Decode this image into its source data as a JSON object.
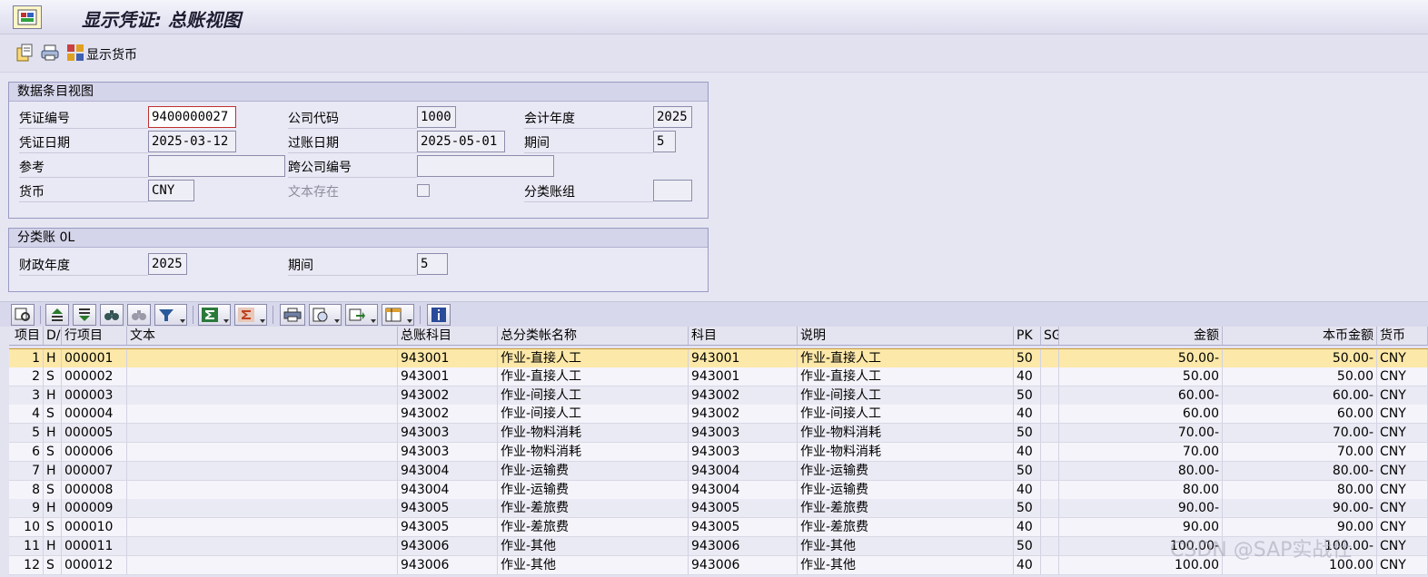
{
  "window": {
    "title": "显示凭证: 总账视图"
  },
  "toolbar": {
    "display_currency_label": "显示货币",
    "icons": [
      "display-change-icon",
      "print-icon",
      "display-currency-icon"
    ]
  },
  "header_group": {
    "title": "数据条目视图",
    "doc_number_label": "凭证编号",
    "doc_number": "9400000027",
    "company_code_label": "公司代码",
    "company_code": "1000",
    "fiscal_year_label": "会计年度",
    "fiscal_year": "2025",
    "doc_date_label": "凭证日期",
    "doc_date": "2025-03-12",
    "posting_date_label": "过账日期",
    "posting_date": "2025-05-01",
    "period_label": "期间",
    "period": "5",
    "reference_label": "参考",
    "reference": "",
    "cross_company_label": "跨公司编号",
    "cross_company": "",
    "currency_label": "货币",
    "currency": "CNY",
    "text_exists_label": "文本存在",
    "ledger_group_label": "分类账组",
    "ledger_group": ""
  },
  "ledger_group": {
    "title": "分类账 0L",
    "fiscal_year_label": "财政年度",
    "fiscal_year": "2025",
    "period_label": "期间",
    "period": "5"
  },
  "grid": {
    "headers": [
      "项目",
      "D/",
      "行项目",
      "文本",
      "总账科目",
      "总分类帐名称",
      "科目",
      "说明",
      "PK",
      "SG",
      "金额",
      "本币金额",
      "货币"
    ],
    "rows": [
      [
        "1",
        "H",
        "000001",
        "",
        "943001",
        "作业-直接人工",
        "943001",
        "作业-直接人工",
        "50",
        "",
        "50.00-",
        "50.00-",
        "CNY"
      ],
      [
        "2",
        "S",
        "000002",
        "",
        "943001",
        "作业-直接人工",
        "943001",
        "作业-直接人工",
        "40",
        "",
        "50.00",
        "50.00",
        "CNY"
      ],
      [
        "3",
        "H",
        "000003",
        "",
        "943002",
        "作业-间接人工",
        "943002",
        "作业-间接人工",
        "50",
        "",
        "60.00-",
        "60.00-",
        "CNY"
      ],
      [
        "4",
        "S",
        "000004",
        "",
        "943002",
        "作业-间接人工",
        "943002",
        "作业-间接人工",
        "40",
        "",
        "60.00",
        "60.00",
        "CNY"
      ],
      [
        "5",
        "H",
        "000005",
        "",
        "943003",
        "作业-物料消耗",
        "943003",
        "作业-物料消耗",
        "50",
        "",
        "70.00-",
        "70.00-",
        "CNY"
      ],
      [
        "6",
        "S",
        "000006",
        "",
        "943003",
        "作业-物料消耗",
        "943003",
        "作业-物料消耗",
        "40",
        "",
        "70.00",
        "70.00",
        "CNY"
      ],
      [
        "7",
        "H",
        "000007",
        "",
        "943004",
        "作业-运输费",
        "943004",
        "作业-运输费",
        "50",
        "",
        "80.00-",
        "80.00-",
        "CNY"
      ],
      [
        "8",
        "S",
        "000008",
        "",
        "943004",
        "作业-运输费",
        "943004",
        "作业-运输费",
        "40",
        "",
        "80.00",
        "80.00",
        "CNY"
      ],
      [
        "9",
        "H",
        "000009",
        "",
        "943005",
        "作业-差旅费",
        "943005",
        "作业-差旅费",
        "50",
        "",
        "90.00-",
        "90.00-",
        "CNY"
      ],
      [
        "10",
        "S",
        "000010",
        "",
        "943005",
        "作业-差旅费",
        "943005",
        "作业-差旅费",
        "40",
        "",
        "90.00",
        "90.00",
        "CNY"
      ],
      [
        "11",
        "H",
        "000011",
        "",
        "943006",
        "作业-其他",
        "943006",
        "作业-其他",
        "50",
        "",
        "100.00-",
        "100.00-",
        "CNY"
      ],
      [
        "12",
        "S",
        "000012",
        "",
        "943006",
        "作业-其他",
        "943006",
        "作业-其他",
        "40",
        "",
        "100.00",
        "100.00",
        "CNY"
      ]
    ],
    "selected_row": 0
  },
  "watermark": "CSDN @SAP实战仕",
  "colors": {
    "selected_row": "#fce8a8",
    "background": "#e3e3f0",
    "group_header": "#d4d4ea"
  }
}
